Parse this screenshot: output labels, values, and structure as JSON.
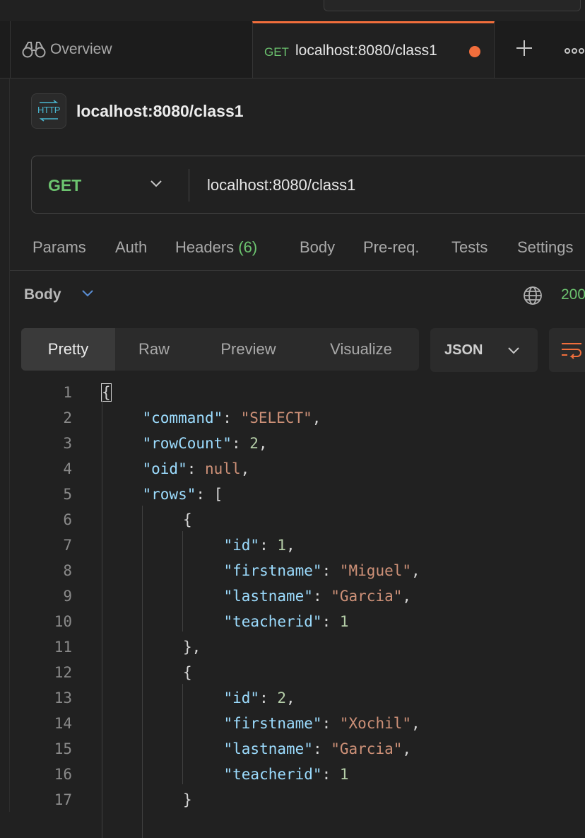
{
  "tabbar": {
    "overview_label": "Overview",
    "request_tab": {
      "method": "GET",
      "label": "localhost:8080/class1"
    }
  },
  "request": {
    "title": "localhost:8080/class1",
    "method": "GET",
    "url": "localhost:8080/class1"
  },
  "request_tabs": [
    "Params",
    "Auth",
    "Headers",
    "Body",
    "Pre-req.",
    "Tests",
    "Settings"
  ],
  "headers_count": "(6)",
  "response": {
    "section_label": "Body",
    "status": "200",
    "view_tabs": [
      "Pretty",
      "Raw",
      "Preview",
      "Visualize"
    ],
    "active_view": "Pretty",
    "format": "JSON"
  },
  "code_lines": [
    {
      "n": "1",
      "indent": 0,
      "tokens": [
        [
          "p",
          "{"
        ]
      ]
    },
    {
      "n": "2",
      "indent": 1,
      "tokens": [
        [
          "k",
          "\"command\""
        ],
        [
          "p",
          ": "
        ],
        [
          "s",
          "\"SELECT\""
        ],
        [
          "p",
          ","
        ]
      ]
    },
    {
      "n": "3",
      "indent": 1,
      "tokens": [
        [
          "k",
          "\"rowCount\""
        ],
        [
          "p",
          ": "
        ],
        [
          "n",
          "2"
        ],
        [
          "p",
          ","
        ]
      ]
    },
    {
      "n": "4",
      "indent": 1,
      "tokens": [
        [
          "k",
          "\"oid\""
        ],
        [
          "p",
          ": "
        ],
        [
          "s",
          "null"
        ],
        [
          "p",
          ","
        ]
      ]
    },
    {
      "n": "5",
      "indent": 1,
      "tokens": [
        [
          "k",
          "\"rows\""
        ],
        [
          "p",
          ": ["
        ]
      ]
    },
    {
      "n": "6",
      "indent": 2,
      "tokens": [
        [
          "p",
          "{"
        ]
      ]
    },
    {
      "n": "7",
      "indent": 3,
      "tokens": [
        [
          "k",
          "\"id\""
        ],
        [
          "p",
          ": "
        ],
        [
          "n",
          "1"
        ],
        [
          "p",
          ","
        ]
      ]
    },
    {
      "n": "8",
      "indent": 3,
      "tokens": [
        [
          "k",
          "\"firstname\""
        ],
        [
          "p",
          ": "
        ],
        [
          "s",
          "\"Miguel\""
        ],
        [
          "p",
          ","
        ]
      ]
    },
    {
      "n": "9",
      "indent": 3,
      "tokens": [
        [
          "k",
          "\"lastname\""
        ],
        [
          "p",
          ": "
        ],
        [
          "s",
          "\"Garcia\""
        ],
        [
          "p",
          ","
        ]
      ]
    },
    {
      "n": "10",
      "indent": 3,
      "tokens": [
        [
          "k",
          "\"teacherid\""
        ],
        [
          "p",
          ": "
        ],
        [
          "n",
          "1"
        ]
      ]
    },
    {
      "n": "11",
      "indent": 2,
      "tokens": [
        [
          "p",
          "},"
        ]
      ]
    },
    {
      "n": "12",
      "indent": 2,
      "tokens": [
        [
          "p",
          "{"
        ]
      ]
    },
    {
      "n": "13",
      "indent": 3,
      "tokens": [
        [
          "k",
          "\"id\""
        ],
        [
          "p",
          ": "
        ],
        [
          "n",
          "2"
        ],
        [
          "p",
          ","
        ]
      ]
    },
    {
      "n": "14",
      "indent": 3,
      "tokens": [
        [
          "k",
          "\"firstname\""
        ],
        [
          "p",
          ": "
        ],
        [
          "s",
          "\"Xochil\""
        ],
        [
          "p",
          ","
        ]
      ]
    },
    {
      "n": "15",
      "indent": 3,
      "tokens": [
        [
          "k",
          "\"lastname\""
        ],
        [
          "p",
          ": "
        ],
        [
          "s",
          "\"Garcia\""
        ],
        [
          "p",
          ","
        ]
      ]
    },
    {
      "n": "16",
      "indent": 3,
      "tokens": [
        [
          "k",
          "\"teacherid\""
        ],
        [
          "p",
          ": "
        ],
        [
          "n",
          "1"
        ]
      ]
    },
    {
      "n": "17",
      "indent": 2,
      "tokens": [
        [
          "p",
          "}"
        ]
      ]
    }
  ],
  "colors": {
    "accent_orange": "#f16e3c",
    "method_green": "#6cc36f",
    "json_key": "#9cdcfe",
    "json_string": "#ce9178",
    "json_number": "#b5cea8"
  },
  "icons": [
    "binoculars-icon",
    "http-icon",
    "chevron-down-icon",
    "plus-icon",
    "more-icon",
    "globe-icon",
    "wrap-lines-icon"
  ]
}
